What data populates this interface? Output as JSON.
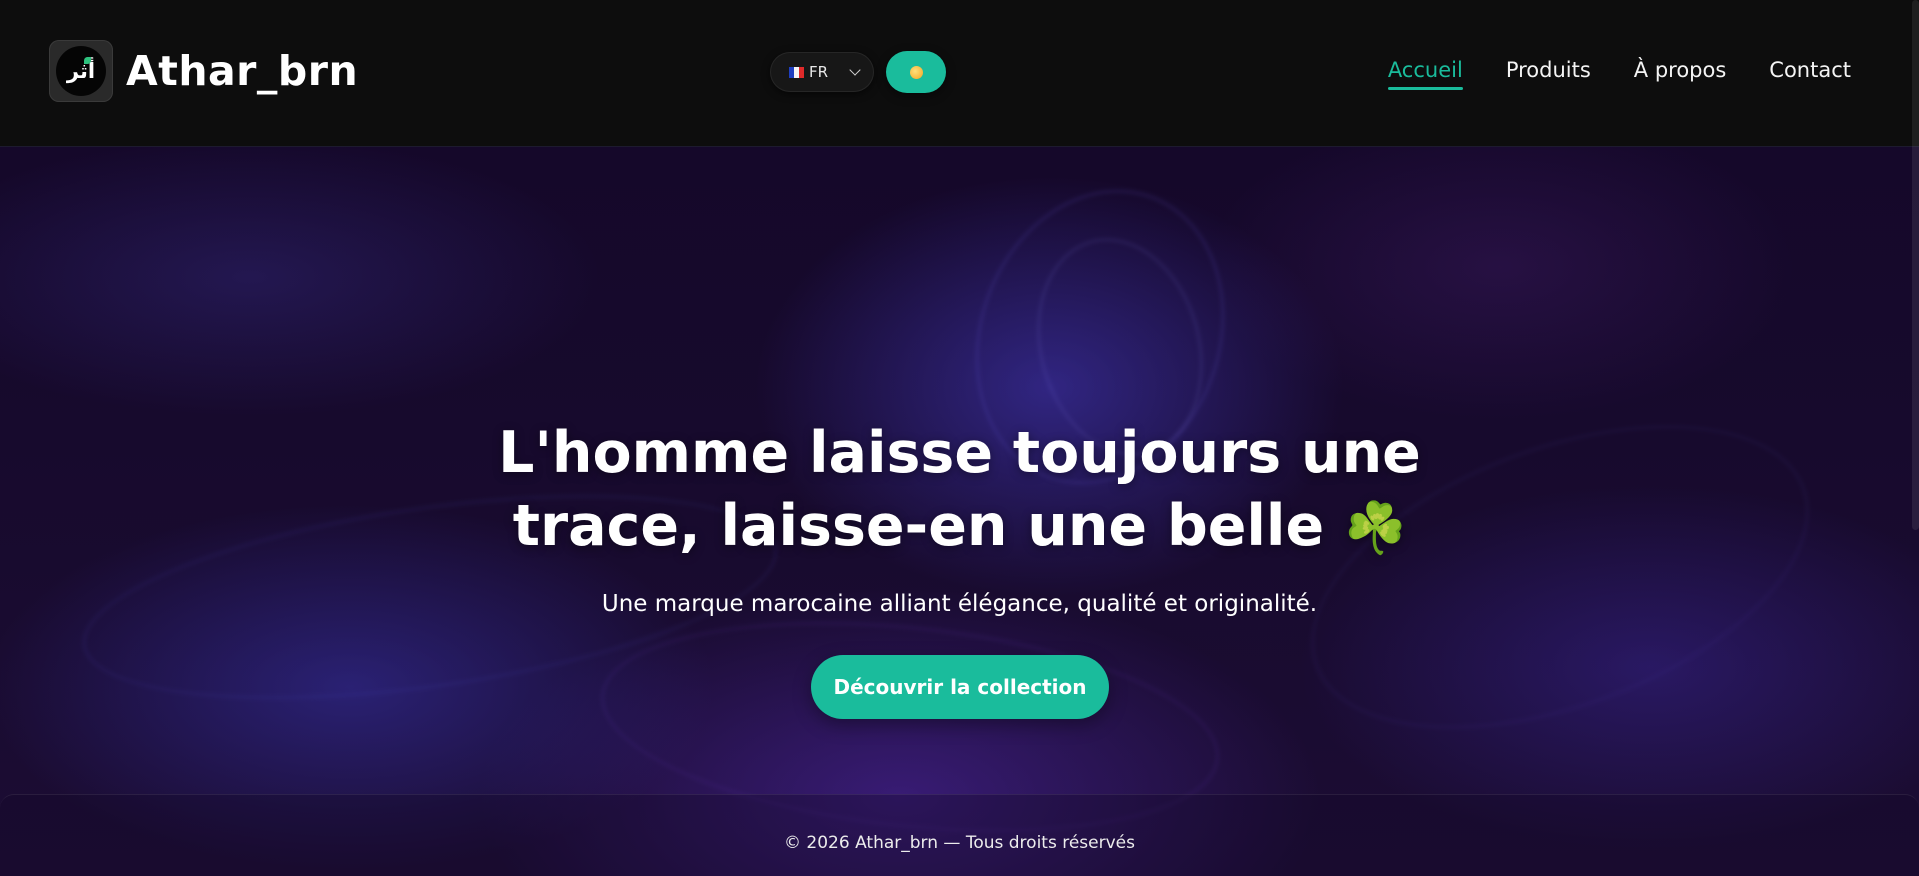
{
  "brand": {
    "name": "Athar_brn",
    "logo_glyph": "أثر",
    "logo_icon": "brand-logo-icon"
  },
  "language": {
    "flag": "french-flag-icon",
    "code": "FR"
  },
  "theme_toggle": {
    "icon": "sun-icon"
  },
  "nav": {
    "items": [
      {
        "label": "Accueil",
        "active": true
      },
      {
        "label": "Produits",
        "active": false
      },
      {
        "label": "À propos",
        "active": false
      },
      {
        "label": "Contact",
        "active": false
      }
    ]
  },
  "hero": {
    "title_line1": "L'homme laisse toujours une",
    "title_line2": "trace, laisse-en une belle",
    "title_emoji": "☘️",
    "subtitle": "Une marque marocaine alliant élégance, qualité et originalité.",
    "cta_label": "Découvrir la collection"
  },
  "footer": {
    "text": "© 2026 Athar_brn — Tous droits réservés"
  },
  "colors": {
    "accent": "#1abc9c",
    "header_bg": "#0d0d0d",
    "hero_bg": "#170a2d"
  }
}
